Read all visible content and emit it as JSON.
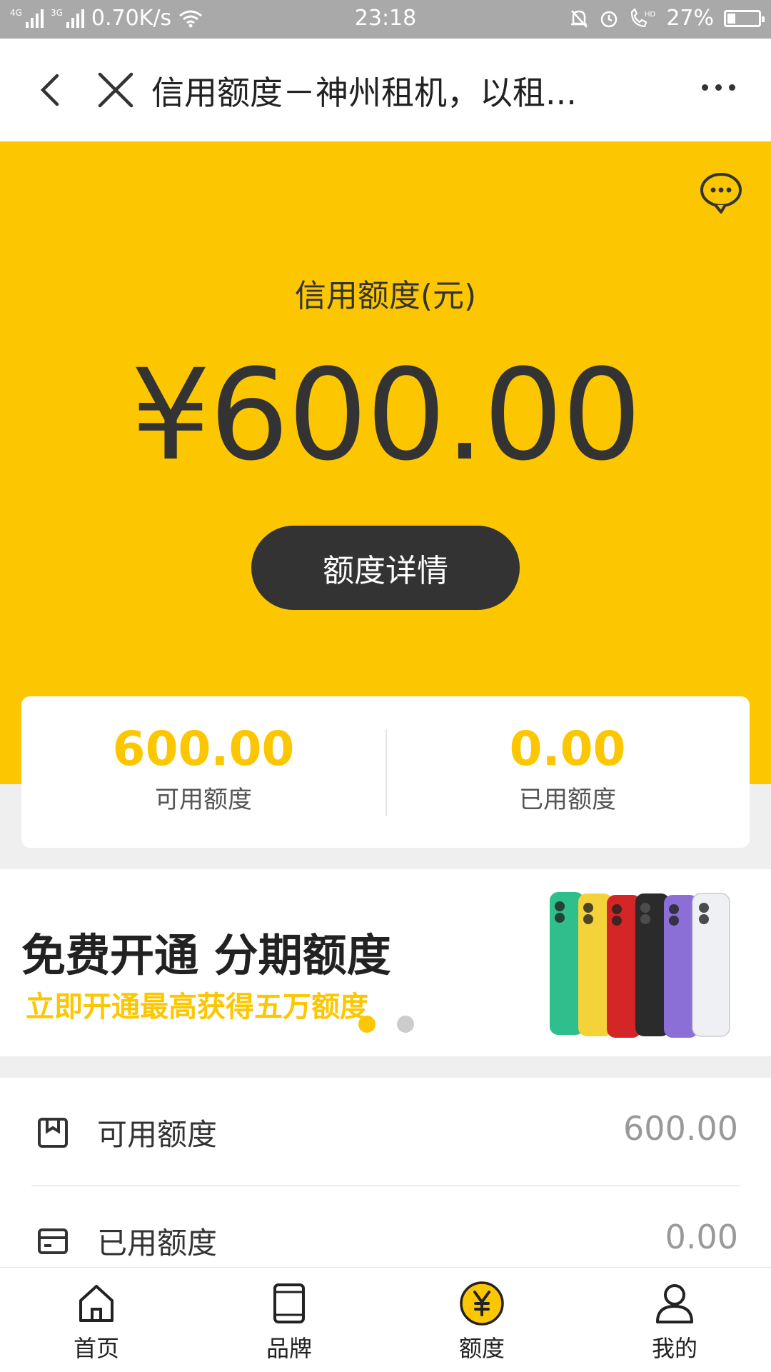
{
  "status_bar": {
    "net1": "4G",
    "net2": "3G",
    "speed": "0.70K/s",
    "time": "23:18",
    "battery": "27%",
    "battery_level": 0.27
  },
  "nav": {
    "title": "信用额度－神州租机，以租..."
  },
  "hero": {
    "label": "信用额度(元)",
    "amount": "¥600.00",
    "button": "额度详情"
  },
  "summary": {
    "available_value": "600.00",
    "available_label": "可用额度",
    "used_value": "0.00",
    "used_label": "已用额度"
  },
  "banner": {
    "title": "免费开通 分期额度",
    "subtitle": "立即开通最高获得五万额度",
    "dots_active": 0,
    "dots_count": 2,
    "colors": {
      "active": "#fcc700",
      "inactive": "#cccccc"
    }
  },
  "list": [
    {
      "label": "可用额度",
      "value": "600.00",
      "icon": "bookmark-box-icon"
    },
    {
      "label": "已用额度",
      "value": "0.00",
      "icon": "card-icon"
    }
  ],
  "tabbar": [
    {
      "label": "首页",
      "icon": "home-icon",
      "active": false
    },
    {
      "label": "品牌",
      "icon": "tablet-icon",
      "active": false
    },
    {
      "label": "额度",
      "icon": "yuan-coin-icon",
      "active": true
    },
    {
      "label": "我的",
      "icon": "user-icon",
      "active": false
    }
  ],
  "colors": {
    "accent": "#fcc700",
    "dark": "#333333"
  }
}
